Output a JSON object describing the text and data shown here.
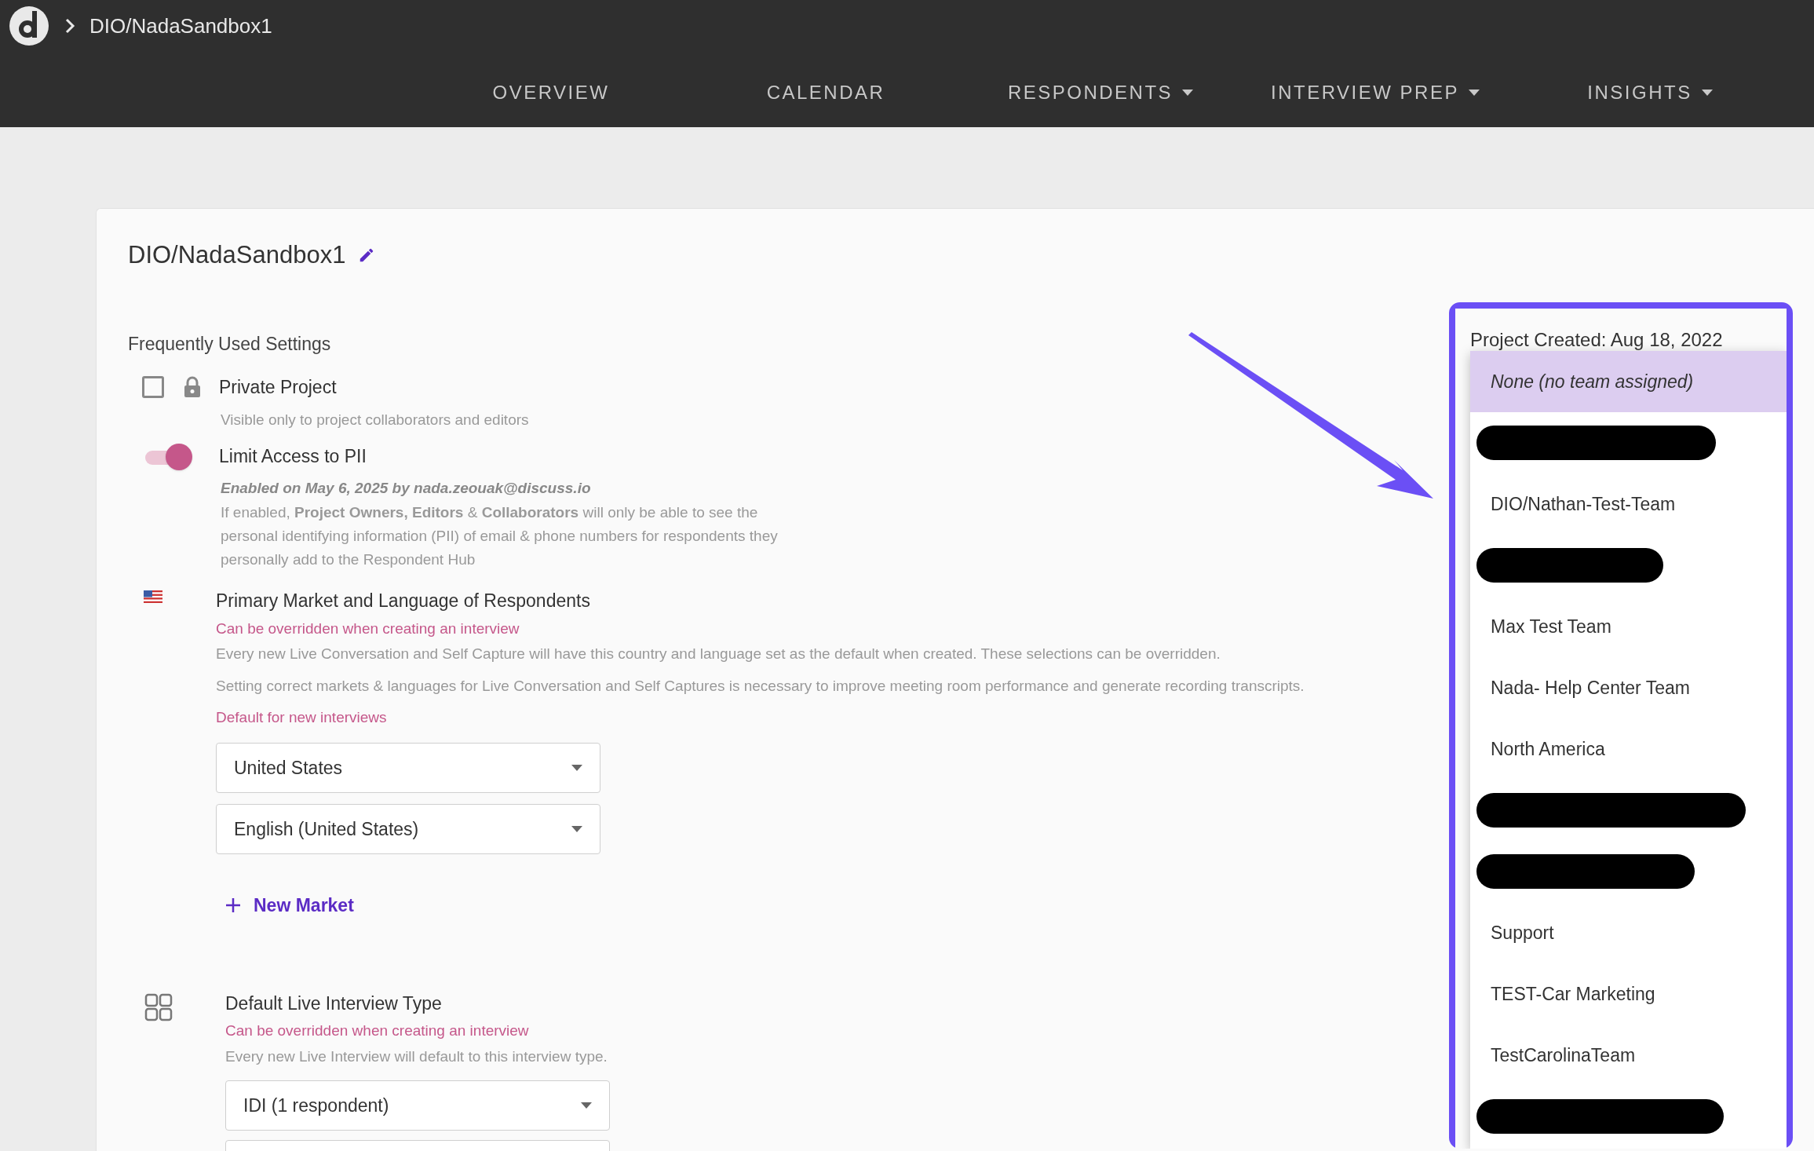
{
  "header": {
    "breadcrumb": "DIO/NadaSandbox1"
  },
  "nav": [
    {
      "label": "OVERVIEW",
      "dropdown": false
    },
    {
      "label": "CALENDAR",
      "dropdown": false
    },
    {
      "label": "RESPONDENTS",
      "dropdown": true
    },
    {
      "label": "INTERVIEW PREP",
      "dropdown": true
    },
    {
      "label": "INSIGHTS",
      "dropdown": true
    }
  ],
  "project": {
    "title": "DIO/NadaSandbox1"
  },
  "settings": {
    "heading": "Frequently Used Settings",
    "private_project": {
      "label": "Private Project",
      "checked": false,
      "description": "Visible only to project collaborators and editors"
    },
    "limit_pii": {
      "label": "Limit Access to PII",
      "on": true,
      "enabled_note": "Enabled on May 6, 2025 by nada.zeouak@discuss.io",
      "description": "If enabled, **Project Owners, Editors** & **Collaborators** will only be able to see the personal identifying information (PII) of email & phone numbers for respondents they personally add to the Respondent Hub"
    },
    "primary_market": {
      "label": "Primary Market and Language of Respondents",
      "override_note": "Can be overridden when creating an interview",
      "description": "Every new Live Conversation and Self Capture will have this country and language set as the default when created. These selections can be overridden.",
      "note": "Setting correct markets & languages for Live Conversation and Self Captures is necessary to improve meeting room performance and generate recording transcripts.",
      "default_label": "Default for new interviews",
      "country_select": {
        "value": "United States"
      },
      "language_select": {
        "value": "English (United States)"
      },
      "add_button": "New Market"
    },
    "interview_type": {
      "label": "Default Live Interview Type",
      "override_note": "Can be overridden when creating an interview",
      "description": "Every new Live Interview will default to this interview type.",
      "type_select": {
        "value": "IDI (1 respondent)"
      }
    }
  },
  "team_menu": {
    "created_label": "Project Created: Aug 18, 2022",
    "items": [
      {
        "kind": "option",
        "label": "None (no team assigned)",
        "selected": true
      },
      {
        "kind": "redacted",
        "selected": false
      },
      {
        "kind": "option",
        "label": "DIO/Nathan-Test-Team",
        "selected": false
      },
      {
        "kind": "redacted",
        "selected": false
      },
      {
        "kind": "option",
        "label": "Max Test Team",
        "selected": false
      },
      {
        "kind": "option",
        "label": "Nada- Help Center Team",
        "selected": false
      },
      {
        "kind": "option",
        "label": "North America",
        "selected": false
      },
      {
        "kind": "redacted",
        "selected": false
      },
      {
        "kind": "redacted",
        "selected": false
      },
      {
        "kind": "option",
        "label": "Support",
        "selected": false
      },
      {
        "kind": "option",
        "label": "TEST-Car Marketing",
        "selected": false
      },
      {
        "kind": "option",
        "label": "TestCarolinaTeam",
        "selected": false
      },
      {
        "kind": "redacted",
        "selected": false
      }
    ]
  }
}
